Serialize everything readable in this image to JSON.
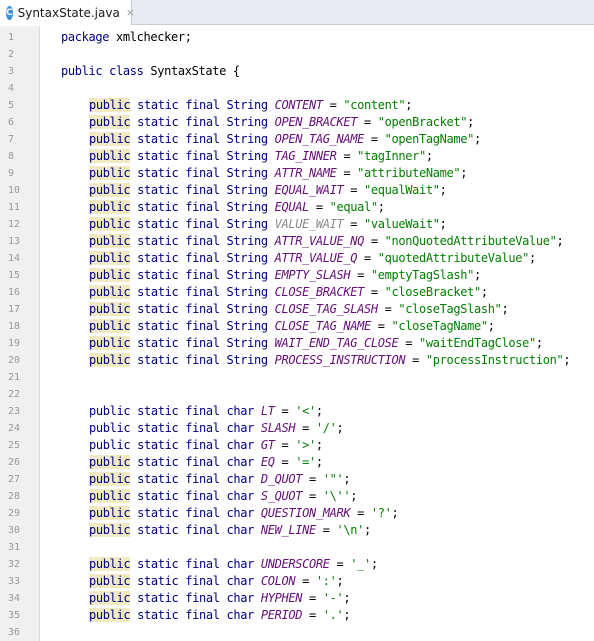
{
  "tab": {
    "icon_letter": "C",
    "title": "SyntaxState.java",
    "close_symbol": "×"
  },
  "line_numbers": [
    "1",
    "2",
    "3",
    "4",
    "5",
    "6",
    "7",
    "8",
    "9",
    "10",
    "11",
    "12",
    "13",
    "14",
    "15",
    "16",
    "17",
    "18",
    "19",
    "20",
    "21",
    "22",
    "23",
    "24",
    "25",
    "26",
    "27",
    "28",
    "29",
    "30",
    "31",
    "32",
    "33",
    "34",
    "35",
    "36"
  ],
  "code": {
    "package_line": {
      "keyword": "package",
      "name": " xmlchecker;"
    },
    "class_line": {
      "keyword": "public class",
      "rest": " SyntaxState {"
    },
    "public_kw": "public",
    "string_prefix": " static final String ",
    "char_prefix": " static final char ",
    "string_fields": [
      {
        "name": "CONTENT",
        "value": "\"content\""
      },
      {
        "name": "OPEN_BRACKET",
        "value": "\"openBracket\""
      },
      {
        "name": "OPEN_TAG_NAME",
        "value": "\"openTagName\""
      },
      {
        "name": "TAG_INNER",
        "value": "\"tagInner\""
      },
      {
        "name": "ATTR_NAME",
        "value": "\"attributeName\""
      },
      {
        "name": "EQUAL_WAIT",
        "value": "\"equalWait\""
      },
      {
        "name": "EQUAL",
        "value": "\"equal\""
      },
      {
        "name": "VALUE_WAIT",
        "value": "\"valueWait\"",
        "unused": true
      },
      {
        "name": "ATTR_VALUE_NQ",
        "value": "\"nonQuotedAttributeValue\""
      },
      {
        "name": "ATTR_VALUE_Q",
        "value": "\"quotedAttributeValue\""
      },
      {
        "name": "EMPTY_SLASH",
        "value": "\"emptyTagSlash\""
      },
      {
        "name": "CLOSE_BRACKET",
        "value": "\"closeBracket\""
      },
      {
        "name": "CLOSE_TAG_SLASH",
        "value": "\"closeTagSlash\""
      },
      {
        "name": "CLOSE_TAG_NAME",
        "value": "\"closeTagName\""
      },
      {
        "name": "WAIT_END_TAG_CLOSE",
        "value": "\"waitEndTagClose\""
      },
      {
        "name": "PROCESS_INSTRUCTION",
        "value": "\"processInstruction\""
      }
    ],
    "char_fields_1": [
      {
        "name": "LT",
        "value": "'<'",
        "highlight": false
      },
      {
        "name": "SLASH",
        "value": "'/'",
        "highlight": false
      },
      {
        "name": "GT",
        "value": "'>'",
        "highlight": false
      },
      {
        "name": "EQ",
        "value": "'='",
        "highlight": true
      },
      {
        "name": "D_QUOT",
        "value": "'\"'",
        "highlight": true
      },
      {
        "name": "S_QUOT",
        "value": "'\\''",
        "highlight": true
      },
      {
        "name": "QUESTION_MARK",
        "value": "'?'",
        "highlight": true
      },
      {
        "name": "NEW_LINE",
        "value": "'\\n'",
        "highlight": true
      }
    ],
    "char_fields_2": [
      {
        "name": "UNDERSCORE",
        "value": "'_'",
        "highlight": true
      },
      {
        "name": "COLON",
        "value": "':'",
        "highlight": true
      },
      {
        "name": "HYPHEN",
        "value": "'-'",
        "highlight": true
      },
      {
        "name": "PERIOD",
        "value": "'.'",
        "highlight": true
      }
    ]
  },
  "colors": {
    "keyword": "#000080",
    "field": "#660e7a",
    "string": "#007f00",
    "highlight": "#f1ebc4",
    "gutter": "#f0f0f0"
  }
}
